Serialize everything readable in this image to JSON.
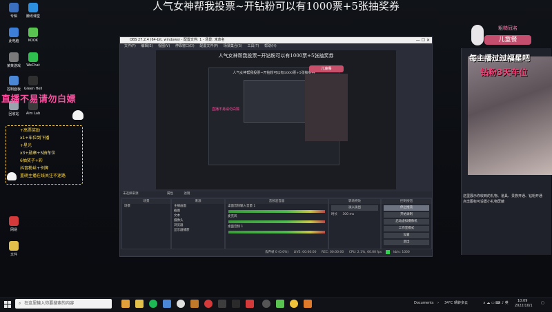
{
  "banner": "人气女神帮我投票~开钻粉可以有1000票+5张抽奖券",
  "desktop_icons": [
    {
      "label": "专辑",
      "color": "#3a6fbf"
    },
    {
      "label": "腾讯课堂",
      "color": "#2d8fe0"
    },
    {
      "label": "此电脑",
      "color": "#3d7ed8"
    },
    {
      "label": "KOOK",
      "color": "#59c44f"
    },
    {
      "label": "某某游戏",
      "color": "#7a7a7a"
    },
    {
      "label": "WeChat",
      "color": "#2fbf4f"
    },
    {
      "label": "控制面板",
      "color": "#4a87d6"
    },
    {
      "label": "Green Hell",
      "color": "#2f2f2f"
    },
    {
      "label": "回收站",
      "color": "#9aa3ad"
    },
    {
      "label": "Aim Lab",
      "color": "#3a3a3a"
    },
    {
      "label": "网易",
      "color": "#d43a3a"
    },
    {
      "label": "文件",
      "color": "#e2c04a"
    }
  ],
  "pink_overlay": "直播不易请勿白嫖",
  "gifts": [
    "+高票奖励",
    "x1+车位到下播",
    "+星光",
    "x3+勋章+5抽车位",
    "6抽奖子+彩",
    "抖音粉丝+卡牌",
    "重磅主播在线关注不迷路"
  ],
  "obs": {
    "title": "OBS 27.2.4 (64-bit, windows) - 配置文件: 1 - 场景: 未命名",
    "menu": [
      "文件(F)",
      "编辑(E)",
      "视图(V)",
      "停靠窗口(D)",
      "配置文件(P)",
      "场景集合(S)",
      "工具(T)",
      "帮助(H)"
    ],
    "preview_title": "人气女神帮我投票~开钻粉可以有1000票+5张抽奖券",
    "nested_title": "人气女神帮我投票~开钻粉可以有1000票+5张抽奖券",
    "nested_pink": "直播不易请勿白嫖",
    "dock_header": "未选择来源",
    "dock_props": "属性",
    "dock_filters": "滤镜",
    "scenes": {
      "title": "场景",
      "items": [
        "场景"
      ]
    },
    "sources": {
      "title": "来源",
      "items": [
        "主播画面",
        "截图",
        "文本",
        "摄像头",
        "浏览器",
        "显示器捕获"
      ]
    },
    "mixer": {
      "title": "音频混音器",
      "channels": [
        {
          "name": "桌面音频输入音量 1",
          "db": "0.0 dB"
        },
        {
          "name": "麦克风",
          "db": "0.0 dB"
        },
        {
          "name": "桌面音频 1",
          "db": "0.0 dB"
        }
      ]
    },
    "transitions": {
      "title": "转场特效",
      "type": "淡入淡出",
      "duration_label": "时长",
      "duration": "300 ms"
    },
    "controls": {
      "title": "控制按钮",
      "buttons": [
        "停止推流",
        "开始录制",
        "启动虚拟摄像机",
        "工作室模式",
        "设置",
        "退出"
      ]
    },
    "status": {
      "dropped": "丢弃帧 0 (0.0%)",
      "live": "LIVE: 00:00:00",
      "rec": "REC: 00:00:00",
      "cpu": "CPU: 2.1%, 60.00 fps",
      "kbps": "kb/s: 1000"
    }
  },
  "right_overlay": {
    "name_tag": "粗糙冠名",
    "name": "儿童餐",
    "line1": "每主播过过福星吧",
    "line2": "钻粉3天车位",
    "chat_msgs": [
      "这里展示你收到的礼物、道具、贵族开通、钻粉开通",
      "点击图标可设置小礼物屏蔽"
    ]
  },
  "taskbar": {
    "search_placeholder": "在这里输入你要搜索的内容",
    "weather": "34°C 晴转多云",
    "time": "10:09",
    "date": "2022/10/1",
    "doc_label": "Documents"
  }
}
